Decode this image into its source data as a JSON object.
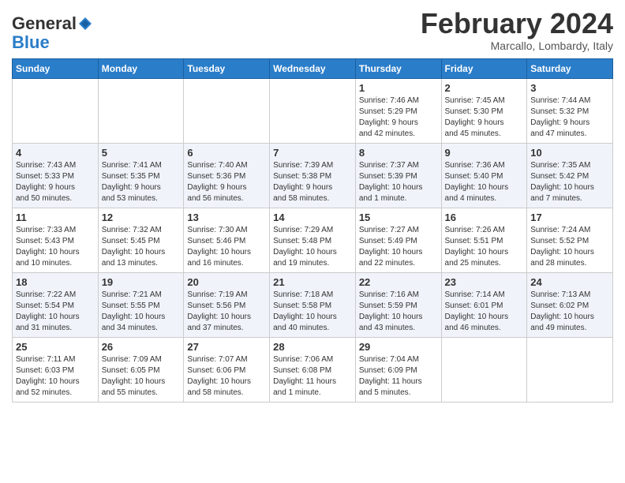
{
  "header": {
    "logo_general": "General",
    "logo_blue": "Blue",
    "month_title": "February 2024",
    "subtitle": "Marcallo, Lombardy, Italy"
  },
  "days_of_week": [
    "Sunday",
    "Monday",
    "Tuesday",
    "Wednesday",
    "Thursday",
    "Friday",
    "Saturday"
  ],
  "weeks": [
    [
      {
        "day": "",
        "info": ""
      },
      {
        "day": "",
        "info": ""
      },
      {
        "day": "",
        "info": ""
      },
      {
        "day": "",
        "info": ""
      },
      {
        "day": "1",
        "info": "Sunrise: 7:46 AM\nSunset: 5:29 PM\nDaylight: 9 hours\nand 42 minutes."
      },
      {
        "day": "2",
        "info": "Sunrise: 7:45 AM\nSunset: 5:30 PM\nDaylight: 9 hours\nand 45 minutes."
      },
      {
        "day": "3",
        "info": "Sunrise: 7:44 AM\nSunset: 5:32 PM\nDaylight: 9 hours\nand 47 minutes."
      }
    ],
    [
      {
        "day": "4",
        "info": "Sunrise: 7:43 AM\nSunset: 5:33 PM\nDaylight: 9 hours\nand 50 minutes."
      },
      {
        "day": "5",
        "info": "Sunrise: 7:41 AM\nSunset: 5:35 PM\nDaylight: 9 hours\nand 53 minutes."
      },
      {
        "day": "6",
        "info": "Sunrise: 7:40 AM\nSunset: 5:36 PM\nDaylight: 9 hours\nand 56 minutes."
      },
      {
        "day": "7",
        "info": "Sunrise: 7:39 AM\nSunset: 5:38 PM\nDaylight: 9 hours\nand 58 minutes."
      },
      {
        "day": "8",
        "info": "Sunrise: 7:37 AM\nSunset: 5:39 PM\nDaylight: 10 hours\nand 1 minute."
      },
      {
        "day": "9",
        "info": "Sunrise: 7:36 AM\nSunset: 5:40 PM\nDaylight: 10 hours\nand 4 minutes."
      },
      {
        "day": "10",
        "info": "Sunrise: 7:35 AM\nSunset: 5:42 PM\nDaylight: 10 hours\nand 7 minutes."
      }
    ],
    [
      {
        "day": "11",
        "info": "Sunrise: 7:33 AM\nSunset: 5:43 PM\nDaylight: 10 hours\nand 10 minutes."
      },
      {
        "day": "12",
        "info": "Sunrise: 7:32 AM\nSunset: 5:45 PM\nDaylight: 10 hours\nand 13 minutes."
      },
      {
        "day": "13",
        "info": "Sunrise: 7:30 AM\nSunset: 5:46 PM\nDaylight: 10 hours\nand 16 minutes."
      },
      {
        "day": "14",
        "info": "Sunrise: 7:29 AM\nSunset: 5:48 PM\nDaylight: 10 hours\nand 19 minutes."
      },
      {
        "day": "15",
        "info": "Sunrise: 7:27 AM\nSunset: 5:49 PM\nDaylight: 10 hours\nand 22 minutes."
      },
      {
        "day": "16",
        "info": "Sunrise: 7:26 AM\nSunset: 5:51 PM\nDaylight: 10 hours\nand 25 minutes."
      },
      {
        "day": "17",
        "info": "Sunrise: 7:24 AM\nSunset: 5:52 PM\nDaylight: 10 hours\nand 28 minutes."
      }
    ],
    [
      {
        "day": "18",
        "info": "Sunrise: 7:22 AM\nSunset: 5:54 PM\nDaylight: 10 hours\nand 31 minutes."
      },
      {
        "day": "19",
        "info": "Sunrise: 7:21 AM\nSunset: 5:55 PM\nDaylight: 10 hours\nand 34 minutes."
      },
      {
        "day": "20",
        "info": "Sunrise: 7:19 AM\nSunset: 5:56 PM\nDaylight: 10 hours\nand 37 minutes."
      },
      {
        "day": "21",
        "info": "Sunrise: 7:18 AM\nSunset: 5:58 PM\nDaylight: 10 hours\nand 40 minutes."
      },
      {
        "day": "22",
        "info": "Sunrise: 7:16 AM\nSunset: 5:59 PM\nDaylight: 10 hours\nand 43 minutes."
      },
      {
        "day": "23",
        "info": "Sunrise: 7:14 AM\nSunset: 6:01 PM\nDaylight: 10 hours\nand 46 minutes."
      },
      {
        "day": "24",
        "info": "Sunrise: 7:13 AM\nSunset: 6:02 PM\nDaylight: 10 hours\nand 49 minutes."
      }
    ],
    [
      {
        "day": "25",
        "info": "Sunrise: 7:11 AM\nSunset: 6:03 PM\nDaylight: 10 hours\nand 52 minutes."
      },
      {
        "day": "26",
        "info": "Sunrise: 7:09 AM\nSunset: 6:05 PM\nDaylight: 10 hours\nand 55 minutes."
      },
      {
        "day": "27",
        "info": "Sunrise: 7:07 AM\nSunset: 6:06 PM\nDaylight: 10 hours\nand 58 minutes."
      },
      {
        "day": "28",
        "info": "Sunrise: 7:06 AM\nSunset: 6:08 PM\nDaylight: 11 hours\nand 1 minute."
      },
      {
        "day": "29",
        "info": "Sunrise: 7:04 AM\nSunset: 6:09 PM\nDaylight: 11 hours\nand 5 minutes."
      },
      {
        "day": "",
        "info": ""
      },
      {
        "day": "",
        "info": ""
      }
    ]
  ]
}
